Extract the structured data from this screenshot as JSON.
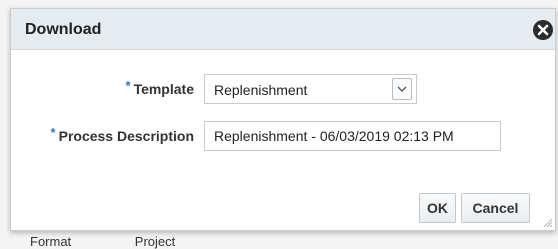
{
  "backdrop": {
    "items": [
      "Format",
      "Project"
    ]
  },
  "dialog": {
    "title": "Download",
    "close_icon": "close-circle-icon"
  },
  "form": {
    "required_marker": "*",
    "template": {
      "label": "Template",
      "value": "Replenishment",
      "arrow_icon": "chevron-down-icon"
    },
    "process_description": {
      "label": "Process Description",
      "value": "Replenishment - 06/03/2019 02:13 PM"
    }
  },
  "buttons": {
    "ok": "OK",
    "cancel": "Cancel"
  },
  "colors": {
    "title_bar": "#e6ebef",
    "required_marker": "#2a78c2",
    "close_button": "#2b2b2b"
  }
}
